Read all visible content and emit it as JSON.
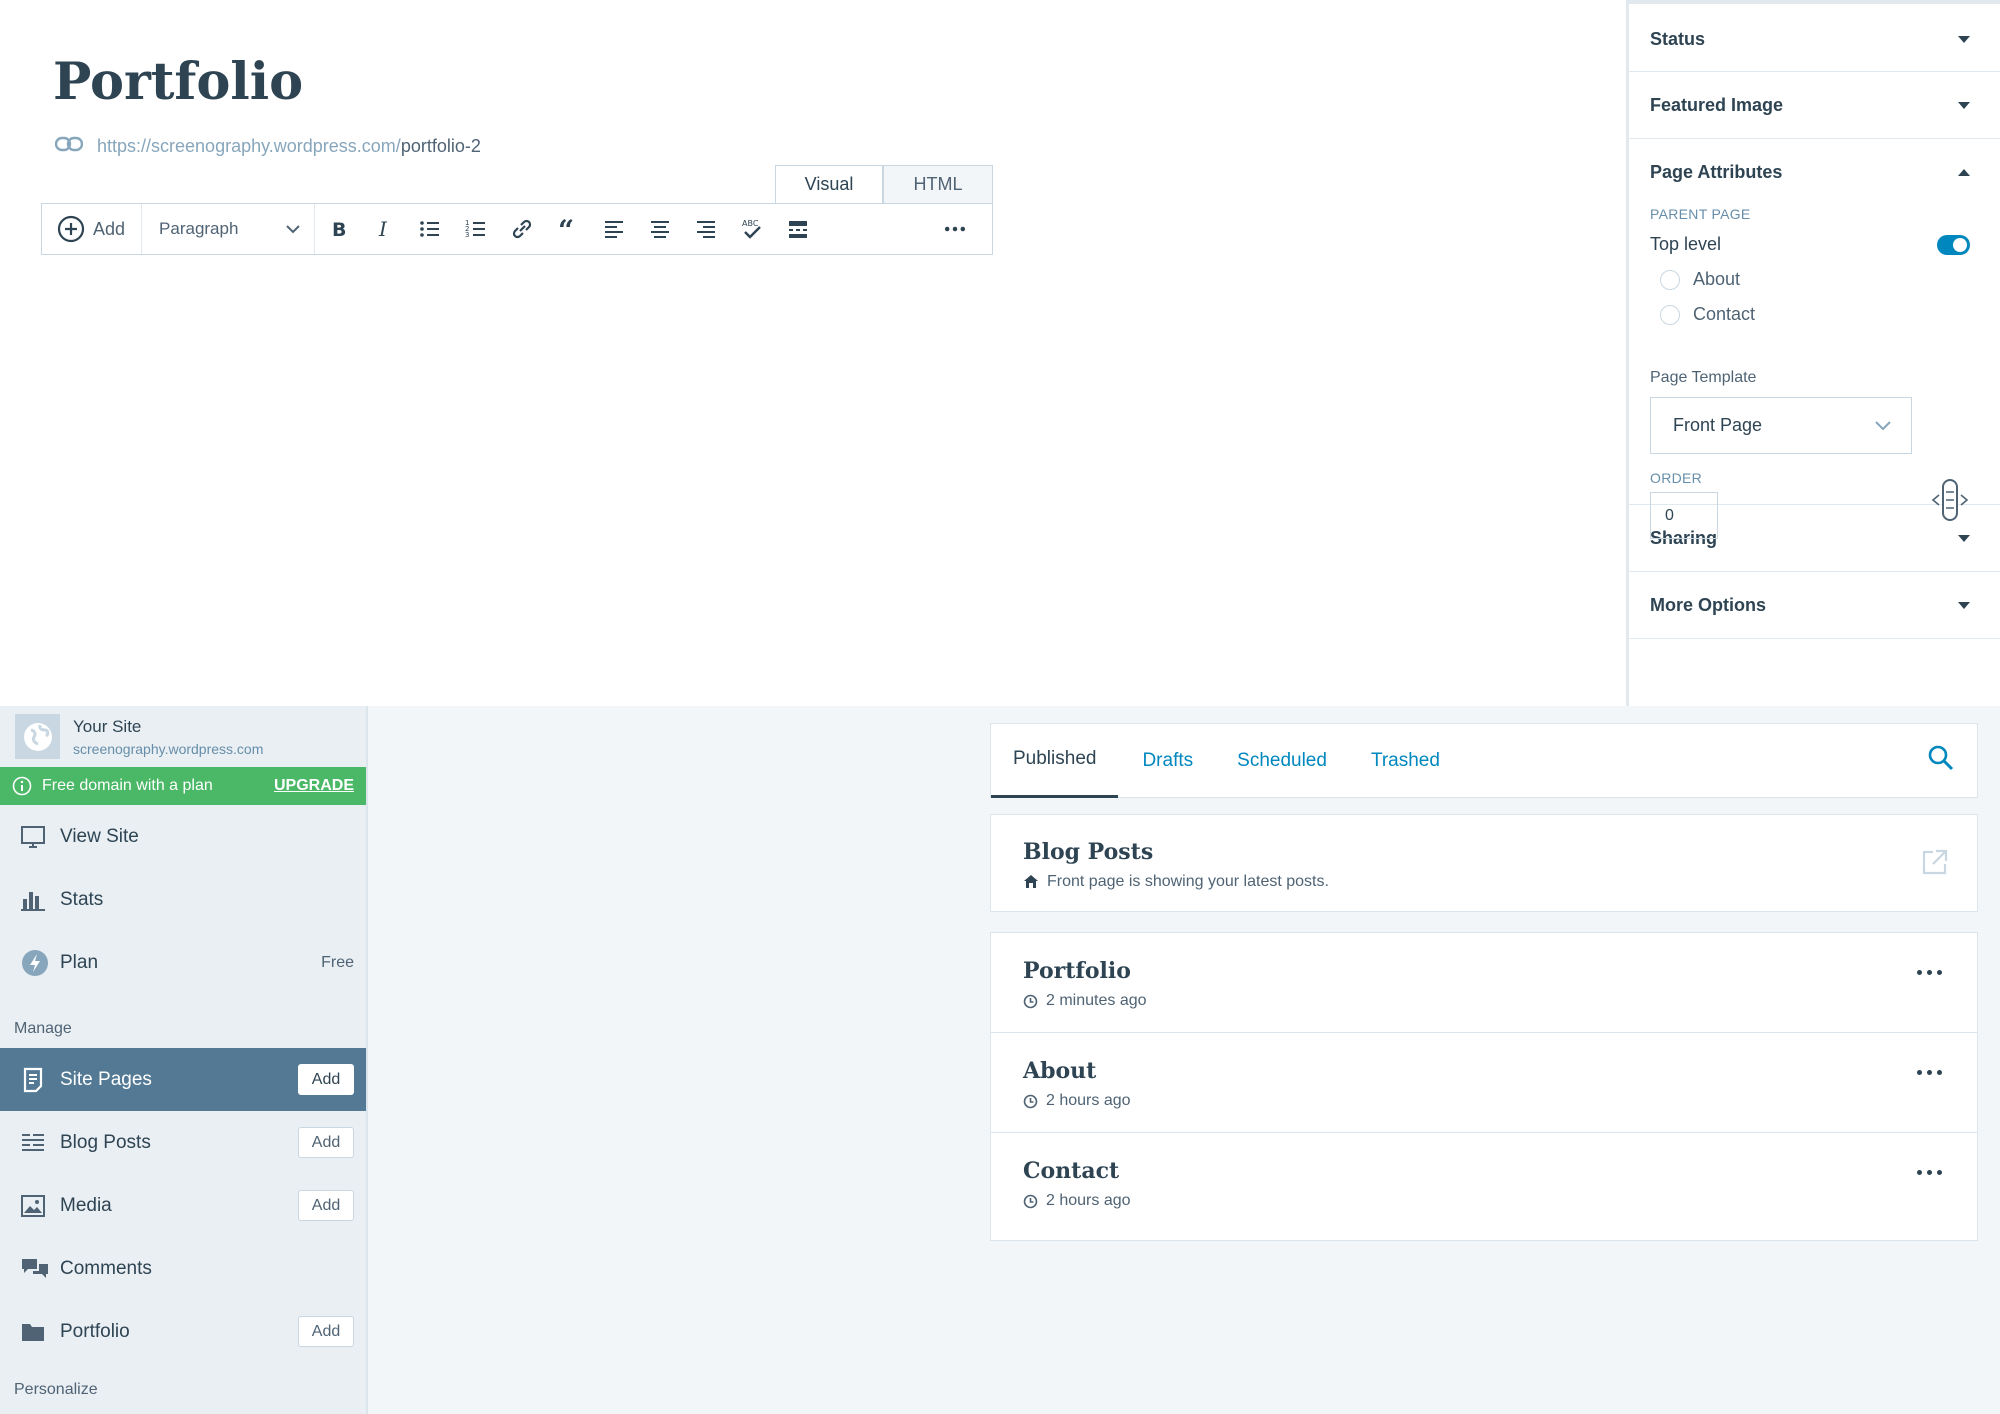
{
  "editor": {
    "title": "Portfolio",
    "permalink_base": "https://screenography.wordpress.com/",
    "permalink_slug": "portfolio-2",
    "tabs": {
      "visual": "Visual",
      "html": "HTML"
    },
    "toolbar": {
      "add_label": "Add",
      "format": "Paragraph"
    }
  },
  "sidebar": {
    "status": "Status",
    "featured_image": "Featured Image",
    "page_attributes": "Page Attributes",
    "parent_page_label": "PARENT PAGE",
    "top_level": "Top level",
    "top_level_on": true,
    "parents": [
      "About",
      "Contact"
    ],
    "page_template_label": "Page Template",
    "page_template_value": "Front Page",
    "order_label": "ORDER",
    "order_value": "0",
    "sharing": "Sharing",
    "more_options": "More Options"
  },
  "nav": {
    "site_name": "Your Site",
    "site_url": "screenography.wordpress.com",
    "promo_text": "Free domain with a plan",
    "promo_cta": "UPGRADE",
    "view_site": "View Site",
    "stats": "Stats",
    "plan": "Plan",
    "plan_value": "Free",
    "manage_heading": "Manage",
    "site_pages": "Site Pages",
    "blog_posts": "Blog Posts",
    "media": "Media",
    "comments": "Comments",
    "portfolio": "Portfolio",
    "add_label": "Add",
    "personalize_heading": "Personalize"
  },
  "pages": {
    "tabs": [
      "Published",
      "Drafts",
      "Scheduled",
      "Trashed"
    ],
    "front": {
      "name": "Blog Posts",
      "note": "Front page is showing your latest posts."
    },
    "rows": [
      {
        "name": "Portfolio",
        "time": "2 minutes ago"
      },
      {
        "name": "About",
        "time": "2 hours ago"
      },
      {
        "name": "Contact",
        "time": "2 hours ago"
      }
    ]
  },
  "colors": {
    "accent": "#0087be",
    "text": "#2e4453",
    "promo": "#4ab866",
    "selected_nav": "#537994"
  }
}
